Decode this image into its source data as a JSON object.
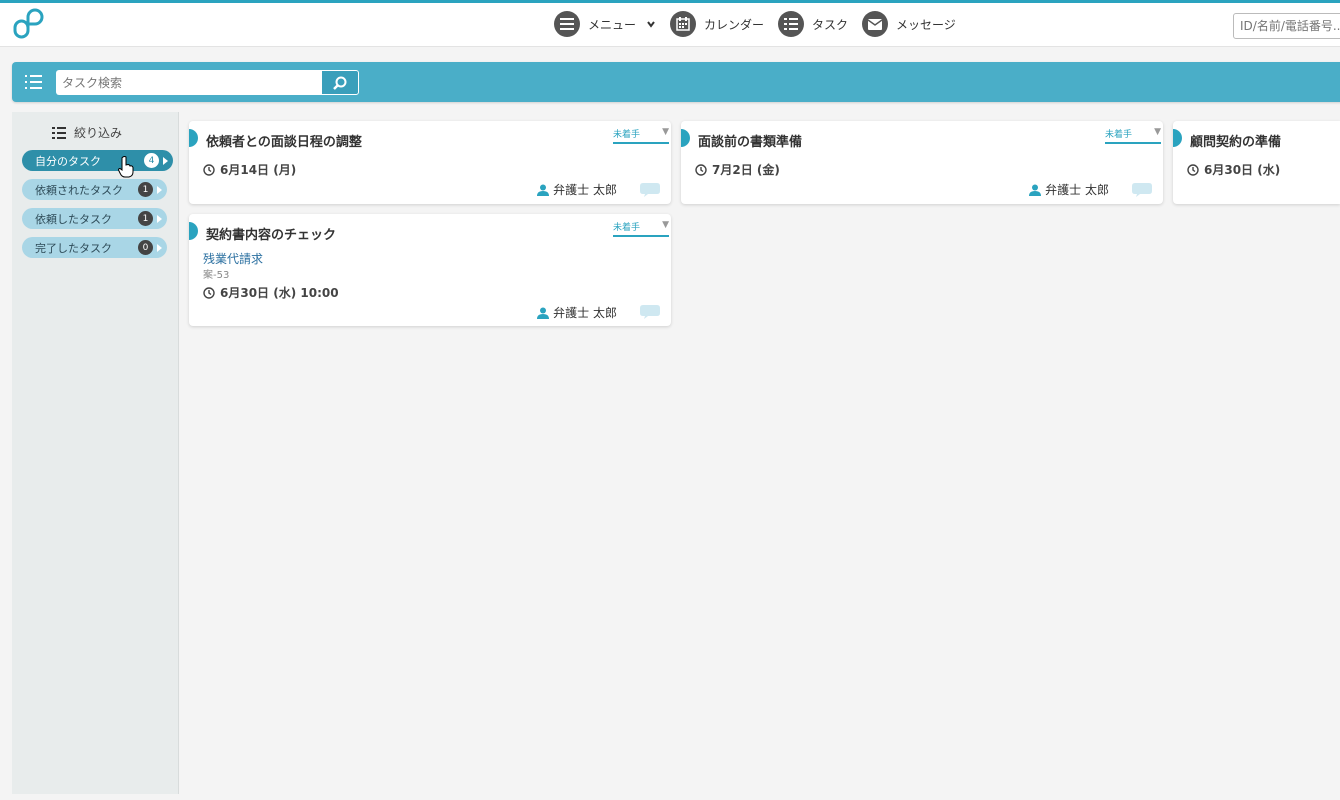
{
  "header": {
    "nav": [
      {
        "label": "メニュー",
        "icon": "menu-icon"
      },
      {
        "label": "カレンダー",
        "icon": "calendar-icon"
      },
      {
        "label": "タスク",
        "icon": "list-icon"
      },
      {
        "label": "メッセージ",
        "icon": "mail-icon"
      }
    ],
    "search_placeholder": "ID/名前/電話番号..."
  },
  "searchbar": {
    "placeholder": "タスク検索"
  },
  "sidebar": {
    "title": "絞り込み",
    "filters": [
      {
        "label": "自分のタスク",
        "count": "4",
        "active": true
      },
      {
        "label": "依頼されたタスク",
        "count": "1",
        "active": false
      },
      {
        "label": "依頼したタスク",
        "count": "1",
        "active": false
      },
      {
        "label": "完了したタスク",
        "count": "0",
        "active": false
      }
    ]
  },
  "cards": [
    {
      "title": "依頼者との面談日程の調整",
      "status": "未着手",
      "date": "6月14日 (月)",
      "assignee": "弁護士 太郎"
    },
    {
      "title": "面談前の書類準備",
      "status": "未着手",
      "date": "7月2日 (金)",
      "assignee": "弁護士 太郎"
    },
    {
      "title": "顧問契約の準備",
      "date": "6月30日 (水)"
    },
    {
      "title": "契約書内容のチェック",
      "status": "未着手",
      "link": "残業代請求",
      "case_id": "案-53",
      "date": "6月30日 (水) 10:00",
      "assignee": "弁護士 太郎"
    }
  ],
  "colors": {
    "accent": "#2aa3bf",
    "searchbar": "#4aaec8",
    "active_filter": "#2e8fa9"
  }
}
